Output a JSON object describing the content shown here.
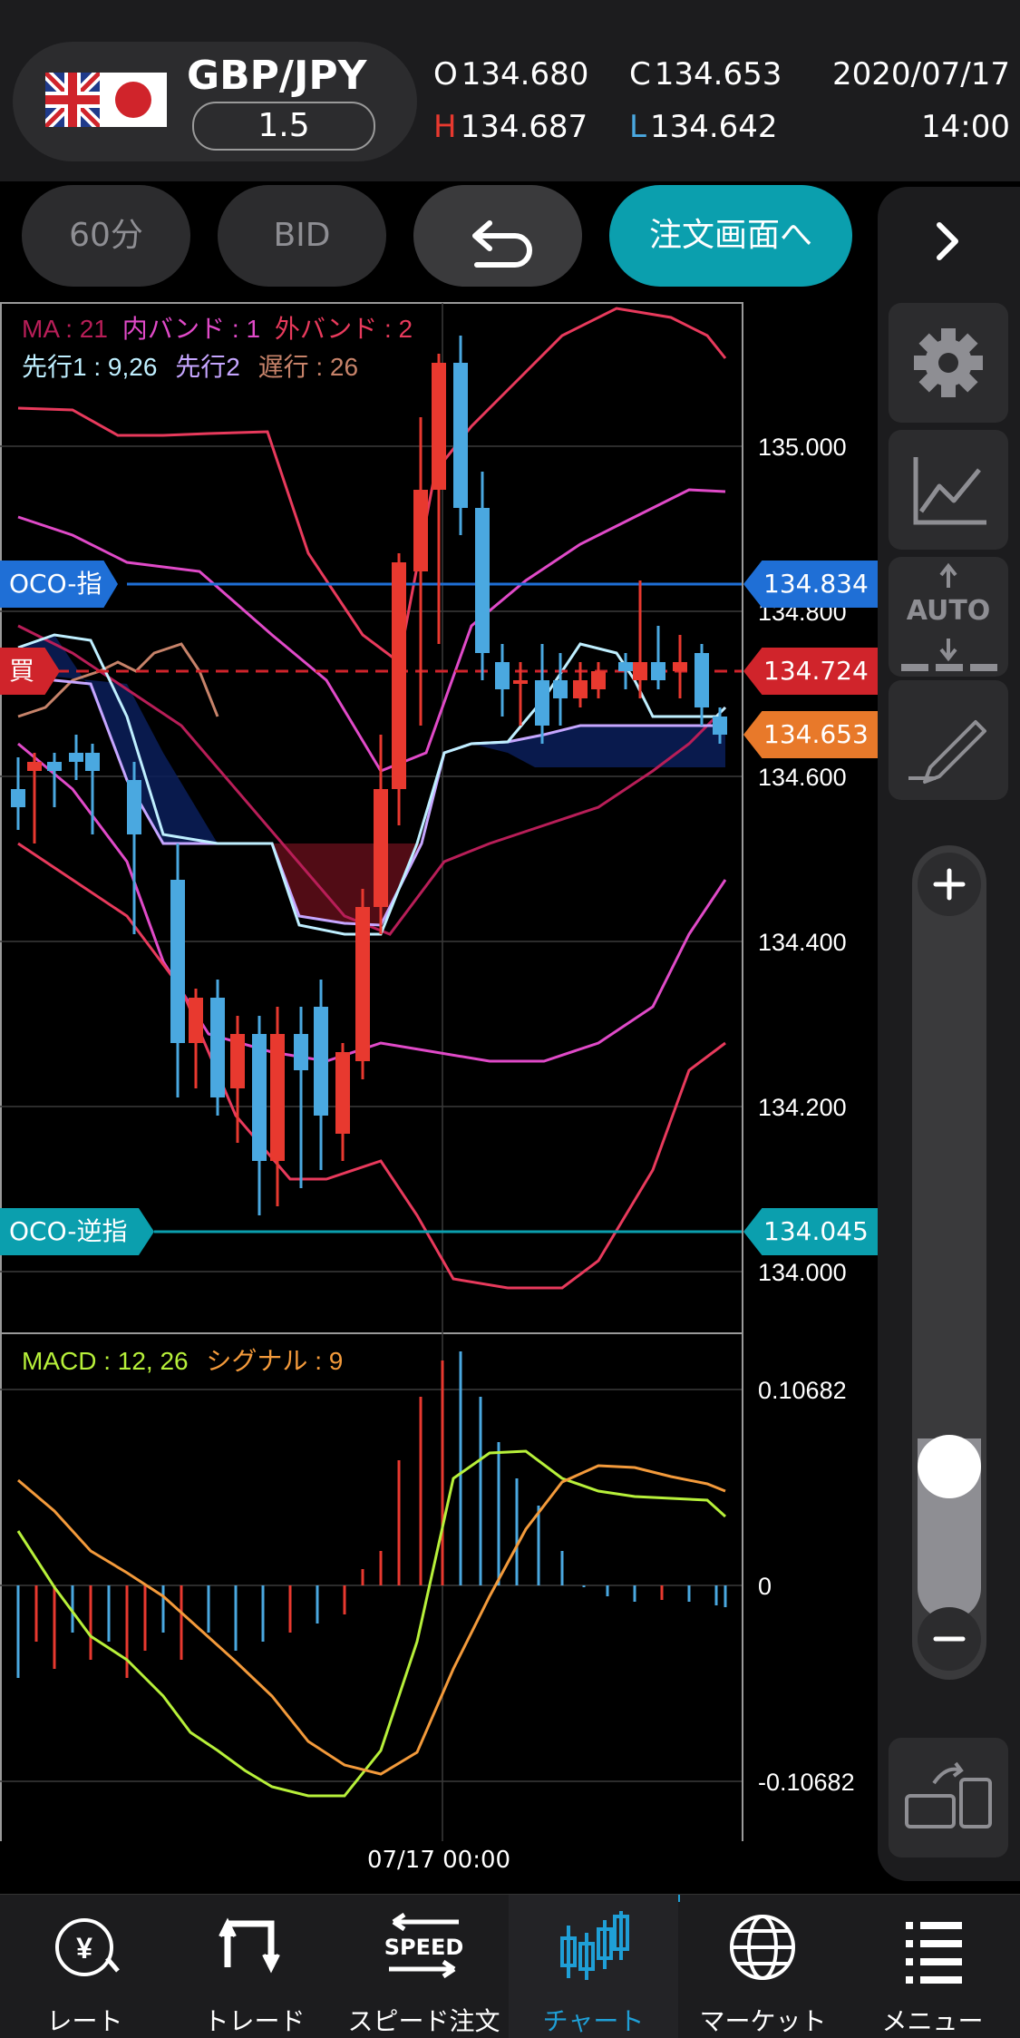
{
  "header": {
    "pair": "GBP/JPY",
    "spread": "1.5",
    "open_label": "O",
    "open": "134.680",
    "high_label": "H",
    "high": "134.687",
    "close_label": "C",
    "close": "134.653",
    "low_label": "L",
    "low": "134.642",
    "date": "2020/07/17",
    "time": "14:00"
  },
  "toolbar": {
    "timeframe": "60分",
    "price_type": "BID",
    "order_button": "注文画面へ"
  },
  "chart": {
    "legend_ma": "MA : 21",
    "legend_inner": "内バンド : 1",
    "legend_outer": "外バンド : 2",
    "legend_senko1": "先行1 : 9,26",
    "legend_senko2": "先行2",
    "legend_chiko": "遅行 : 26",
    "price_axis": [
      "135.000",
      "134.800",
      "134.600",
      "134.400",
      "134.200",
      "134.000"
    ],
    "oco_limit_label": "OCO-指",
    "oco_limit_price": "134.834",
    "oco_stop_label": "OCO-逆指",
    "oco_stop_price": "134.045",
    "position_label": "買",
    "position_price": "134.724",
    "current_price": "134.653",
    "macd_legend": "MACD : 12, 26",
    "signal_legend": "シグナル : 9",
    "macd_axis": [
      "0.10682",
      "0",
      "-0.10682"
    ],
    "time_label": "07/17 00:00",
    "colors": {
      "up": "#e8392f",
      "down": "#4aa8e0",
      "oco_limit": "#1f6fd6",
      "oco_stop": "#0b9fae",
      "position": "#d0242b",
      "current": "#e8792a",
      "macd": "#b7f03a",
      "signal": "#f39a3b",
      "band_outer": "#e83a5c",
      "band_inner": "#e04ac8",
      "ma": "#b81e58",
      "senko1": "#bfefff",
      "senko2": "#c6a6ff",
      "chiko": "#c7836a"
    }
  },
  "sidebar": {
    "auto_label": "AUTO",
    "icons": [
      "settings-gear-icon",
      "line-chart-icon",
      "auto-scale-icon",
      "pencil-draw-icon",
      "zoom-in-icon",
      "zoom-out-icon",
      "layout-switch-icon"
    ]
  },
  "nav": {
    "items": [
      {
        "label": "レート",
        "icon": "rate-icon"
      },
      {
        "label": "トレード",
        "icon": "trade-icon"
      },
      {
        "label": "スピード注文",
        "icon": "speed-order-icon"
      },
      {
        "label": "チャート",
        "icon": "chart-icon"
      },
      {
        "label": "マーケット",
        "icon": "market-globe-icon"
      },
      {
        "label": "メニュー",
        "icon": "menu-icon"
      }
    ],
    "speed_badge": "SPEED",
    "active_index": 3
  }
}
